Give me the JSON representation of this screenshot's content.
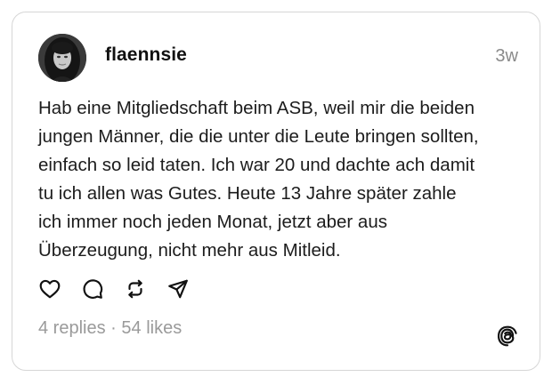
{
  "post": {
    "author": {
      "username": "flaennsie",
      "avatar": "profile-photo"
    },
    "time_ago": "3w",
    "text_lines": [
      "Hab eine Mitgliedschaft beim ASB, weil mir die beiden",
      "jungen Männer, die die unter die Leute bringen sollten,",
      "einfach so leid taten. Ich war 20 und dachte ach damit",
      "tu ich allen was Gutes. Heute 13 Jahre später zahle",
      "ich immer noch jeden Monat, jetzt aber aus",
      "Überzeugung, nicht mehr aus Mitleid."
    ],
    "actions": [
      {
        "name": "like",
        "icon": "heart-icon"
      },
      {
        "name": "reply",
        "icon": "comment-icon"
      },
      {
        "name": "repost",
        "icon": "repost-icon"
      },
      {
        "name": "share",
        "icon": "send-icon"
      }
    ],
    "stats": {
      "replies": "4 replies",
      "separator": "·",
      "likes": "54 likes"
    },
    "brand_icon": "threads-icon"
  },
  "colors": {
    "text": "#1c1c1c",
    "muted": "#8a8a8a",
    "border": "#d6d6d6"
  }
}
